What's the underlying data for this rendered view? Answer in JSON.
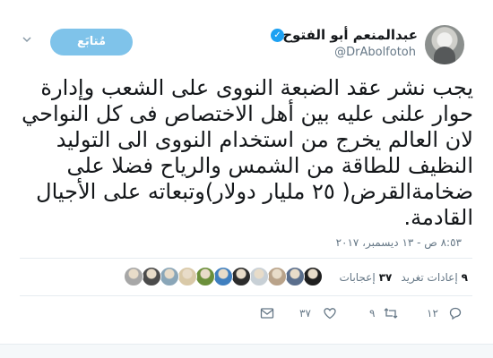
{
  "tweet": {
    "author_name": "عبدالمنعم أبو الفتوح",
    "handle": "@DrAbolfotoh",
    "verified_glyph": "✓",
    "follow_label": "مُتابَع",
    "text": "يجب نشر عقد الضبعة النووى على الشعب وإدارة حوار علنى عليه بين أهل الاختصاص فى كل النواحي لان العالم يخرج من استخدام النووى الى التوليد النظيف للطاقة من الشمس والرياح فضلا على ضخامةالقرض( ٢٥ مليار دولار)وتبعاته على الأجيال القادمة.",
    "timestamp": "٨:٥٣ ص - ١٣ ديسمبر، ٢٠١٧"
  },
  "stats": {
    "retweets_count": "٩",
    "retweets_label": "إعادات تغريد",
    "likes_count": "٣٧",
    "likes_label": "إعجابات"
  },
  "likers": [
    {
      "color": "#1f1f1f"
    },
    {
      "color": "#5a6e8c"
    },
    {
      "color": "#b9a38a"
    },
    {
      "color": "#c8d0d6"
    },
    {
      "color": "#2c2c2c"
    },
    {
      "color": "#3f7fbf"
    },
    {
      "color": "#6b8f3a"
    },
    {
      "color": "#d9c9a8"
    },
    {
      "color": "#8aa6b8"
    },
    {
      "color": "#4b4b4b"
    },
    {
      "color": "#a7a7a7"
    }
  ],
  "actions": {
    "reply_count": "١٢",
    "retweet_count": "٩",
    "like_count": "٣٧"
  },
  "colors": {
    "accent": "#1da1f2",
    "follow_button": "#7fc3ea",
    "muted_text": "#657786"
  }
}
